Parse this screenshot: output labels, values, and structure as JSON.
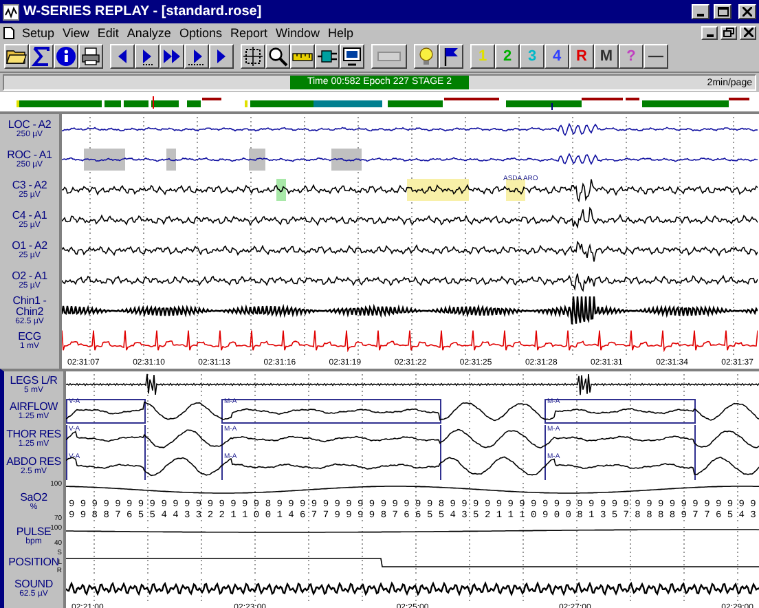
{
  "window": {
    "title": "W-SERIES REPLAY - [standard.rose]"
  },
  "menu": [
    "Setup",
    "View",
    "Edit",
    "Analyze",
    "Options",
    "Report",
    "Window",
    "Help"
  ],
  "toolbar_keys": [
    {
      "label": "1",
      "color": "#e0e000"
    },
    {
      "label": "2",
      "color": "#00b000"
    },
    {
      "label": "3",
      "color": "#00b8c8"
    },
    {
      "label": "4",
      "color": "#3040ff"
    },
    {
      "label": "R",
      "color": "#e00000"
    },
    {
      "label": "M",
      "color": "#303030"
    },
    {
      "label": "?",
      "color": "#c040c0"
    },
    {
      "label": "—",
      "color": "#303030"
    }
  ],
  "status": {
    "info": "Time 00:582 Epoch 227 STAGE 2",
    "scale": "2min/page"
  },
  "upper_channels": [
    {
      "name": "LOC - A2",
      "scale": "250 µV",
      "kind": "eog",
      "color": "#1010a0"
    },
    {
      "name": "ROC - A1",
      "scale": "250 µV",
      "kind": "eog",
      "color": "#1010a0",
      "events": [
        {
          "kind": "shade",
          "color": "#c0c0c0"
        },
        {
          "kind": "shade",
          "color": "#c0c0c0"
        },
        {
          "kind": "shade",
          "color": "#c0c0c0"
        },
        {
          "kind": "shade",
          "color": "#c0c0c0"
        }
      ]
    },
    {
      "name": "C3 - A2",
      "scale": "25 µV",
      "kind": "eeg",
      "color": "#000000",
      "events": [
        {
          "kind": "shade",
          "color": "#a8e8a8"
        },
        {
          "kind": "shade",
          "color": "#f8f0a8"
        },
        {
          "kind": "shade",
          "color": "#f8f0a8",
          "label": "ASDA ARO"
        }
      ]
    },
    {
      "name": "C4 - A1",
      "scale": "25 µV",
      "kind": "eeg",
      "color": "#000000"
    },
    {
      "name": "O1 - A2",
      "scale": "25 µV",
      "kind": "eeg",
      "color": "#000000"
    },
    {
      "name": "O2 - A1",
      "scale": "25 µV",
      "kind": "eeg",
      "color": "#000000"
    },
    {
      "name": "Chin1 - Chin2",
      "scale": "62.5 µV",
      "kind": "emg",
      "color": "#000000"
    },
    {
      "name": "ECG",
      "scale": "1 mV",
      "kind": "ecg",
      "color": "#e00000"
    }
  ],
  "upper_times": [
    "02:31:07",
    "02:31:10",
    "02:31:13",
    "02:31:16",
    "02:31:19",
    "02:31:22",
    "02:31:25",
    "02:31:28",
    "02:31:31",
    "02:31:34",
    "02:31:37"
  ],
  "lower_channels": [
    {
      "name": "LEGS L/R",
      "scale": "5 mV",
      "kind": "legs",
      "color": "#000000"
    },
    {
      "name": "AIRFLOW",
      "scale": "1.25 mV",
      "kind": "resp",
      "color": "#000000",
      "events": [
        {
          "kind": "box",
          "label": "V-A"
        },
        {
          "kind": "box",
          "label": "M-A"
        },
        {
          "kind": "box",
          "label": "M-A"
        }
      ]
    },
    {
      "name": "THOR RES",
      "scale": "1.25 mV",
      "kind": "resp",
      "color": "#000000",
      "events": [
        {
          "kind": "bracket",
          "label": "V-A"
        },
        {
          "kind": "bracket",
          "label": "M-A"
        },
        {
          "kind": "bracket",
          "label": "M-A"
        }
      ]
    },
    {
      "name": "ABDO RES",
      "scale": "2.5 mV",
      "kind": "resp",
      "color": "#000000",
      "events": [
        {
          "kind": "bracket",
          "label": "V-A"
        },
        {
          "kind": "bracket",
          "label": "M-A"
        },
        {
          "kind": "bracket",
          "label": "M-A"
        }
      ]
    },
    {
      "name": "SaO2",
      "scale": "%",
      "kind": "spo2",
      "color": "#000000",
      "axis": [
        "100",
        "70"
      ],
      "readings": [
        "9 9 9 9 9 9 9 9 9 9 9 9 9 9 9 9 9 8 9 9 9 9 9 9 9 9 9 9 9 9 9 9 8 9 9 9 9 9 9 9 9 9 9 9 9 9 9 9 9 9 9 9 9 9 9 9 9 9 9 9",
        "9 9 8 8 7 6 5 5 4 4 3 3 2 2 1 1 0 0 1 4 6 7 7 9 9 9 9 8 7 6 6 5 5 4 3 5 2 1 1 1 0 9 0 0 8 1 3 5 7 8 8 8 8 9 7 7 6 5 4 3"
      ]
    },
    {
      "name": "PULSE",
      "scale": "bpm",
      "kind": "pulse",
      "color": "#000000",
      "axis": [
        "100",
        "40"
      ]
    },
    {
      "name": "POSITION",
      "kind": "position",
      "color": "#000000",
      "axis": [
        "S",
        "L",
        "R"
      ]
    },
    {
      "name": "SOUND",
      "scale": "62.5 µV",
      "kind": "sound",
      "color": "#000000"
    }
  ],
  "lower_times": [
    "02:21:00",
    "02:23:00",
    "02:25:00",
    "02:27:00",
    "02:29:00"
  ]
}
